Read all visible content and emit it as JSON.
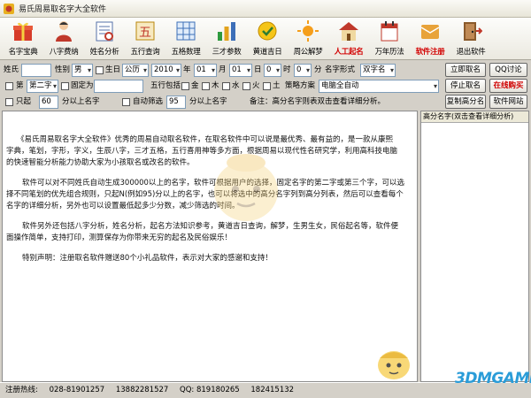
{
  "window": {
    "title": "易氏周易取名字大全软件"
  },
  "toolbar": [
    {
      "label": "名字宝典",
      "icon": "gift-box-icon"
    },
    {
      "label": "八字费纳",
      "icon": "person-icon"
    },
    {
      "label": "姓名分析",
      "icon": "analysis-icon"
    },
    {
      "label": "五行查询",
      "icon": "five-elements-icon"
    },
    {
      "label": "五格数理",
      "icon": "grid-icon"
    },
    {
      "label": "三才参数",
      "icon": "bar-chart-icon"
    },
    {
      "label": "黄道吉日",
      "icon": "calendar-icon"
    },
    {
      "label": "周公解梦",
      "icon": "sun-icon"
    },
    {
      "label": "人工起名",
      "icon": "house-icon"
    },
    {
      "label": "万年历法",
      "icon": "almanac-icon"
    },
    {
      "label": "软件注册",
      "icon": "register-icon"
    },
    {
      "label": "退出软件",
      "icon": "exit-icon"
    }
  ],
  "form": {
    "surname_label": "姓氏",
    "surname_value": "",
    "gender_label": "性别",
    "gender_value": "男",
    "birth_label": "生日",
    "calendar_value": "公历",
    "year_value": "2010",
    "year_unit": "年",
    "month_value": "01",
    "month_unit": "月",
    "day_value": "01",
    "day_unit": "日",
    "hour_value": "0",
    "hour_unit": "时",
    "minute_value": "0",
    "minute_unit": "分",
    "name_form_label": "名字形式",
    "name_form_value": "双字名",
    "start_button": "立即取名",
    "qq_button": "QQ讨论",
    "row2_check_prefix": "第",
    "fixed_position_value": "第二字",
    "fixed_label": "固定为",
    "fixed_value": "",
    "wuxing_label": "五行包括",
    "wuxing": [
      "金",
      "木",
      "水",
      "火",
      "土"
    ],
    "scheme_label": "策略方案",
    "scheme_value": "电脑全自动",
    "stop_button": "停止取名",
    "buy_button": "在线购买",
    "only_label": "只起",
    "only_value": "60",
    "only_suffix": "分以上名字",
    "auto_label": "自动筛选",
    "auto_value": "95",
    "auto_suffix": "分以上名字",
    "remark": "备注：高分名字则表双击查看详细分析。",
    "copy_button": "复制高分名",
    "website_button": "软件网站"
  },
  "side_panel": {
    "header": "高分名字(双击查看详细分析)"
  },
  "main_text": [
    "《易氏周易取名字大全软件》优秀的周易自动取名软件，在取名软件中可以说是最优秀、最有益的，是一款从康熙",
    "字典，笔划，字形，字义，生辰八字，三才五格，五行喜用神等多方面，根据周易以现代性名研究学，利用高科技电脑",
    "的快速智能分析能力协助大家为小孩取名或改名的软件。",
    "软件可以对不同姓氏自动生成300000以上的名字，软件可根据用户的选择，固定名字的第二字或第三个字，可以选",
    "择不同笔划的优先组合规则，只起N(例如95)分以上的名字，也可以将选中的高分名字列到高分列表，然后可以查看每个",
    "名字的详细分析，另外也可以设置最低起多少分数，减少筛选的时间。",
    "软件另外还包括八字分析，姓名分析，起名方法知识参考，黄道吉日查询，解梦，生男生女，民俗起名等，软件便",
    "面操作简单，支持打印，测算保存为你带来无穷的起名及民俗娱乐！",
    "特别声明：注册取名软件赠送80个小礼品软件，表示对大家的感谢和支持！"
  ],
  "status": {
    "hotline_label": "注册热线:",
    "phone1": "028-81901257",
    "phone2": "13882281527",
    "qq": "QQ: 819180265",
    "qq2": "182415132"
  },
  "watermark": "3DMGAME",
  "colors": {
    "accent_red": "#d20000",
    "field_border": "#7f9db9",
    "window_bg": "#d4d0c8"
  }
}
